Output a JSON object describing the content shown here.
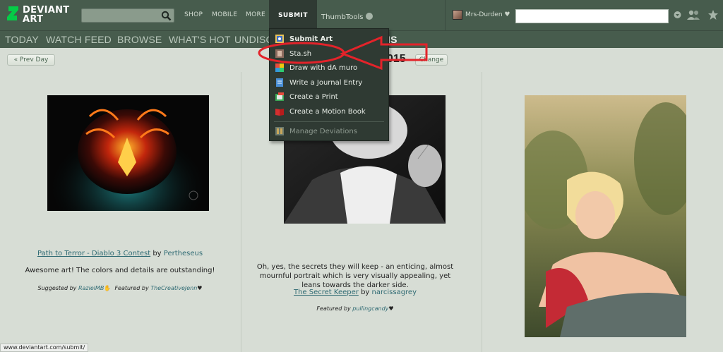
{
  "header": {
    "logo_line1": "DEVIANT",
    "logo_line2": "ART",
    "search": {
      "value": "",
      "placeholder": ""
    },
    "nav": {
      "shop": "SHOP",
      "mobile": "MOBILE",
      "more": "MORE",
      "submit": "SUBMIT",
      "thumbtools": "ThumbTools"
    },
    "username": "Mrs-Durden"
  },
  "subnav": {
    "items": [
      "TODAY",
      "WATCH FEED",
      "BROWSE",
      "WHAT'S HOT",
      "UNDISC",
      "IS"
    ]
  },
  "daybar": {
    "prev_label": "« Prev Day",
    "date_fragment": "015",
    "change_label": "Change"
  },
  "submit_menu": {
    "items": [
      {
        "label": "Submit Art",
        "icon": "submit-art-icon"
      },
      {
        "label": "Sta.sh",
        "icon": "stash-icon"
      },
      {
        "label": "Draw with dA muro",
        "icon": "muro-icon"
      },
      {
        "label": "Write a Journal Entry",
        "icon": "journal-icon"
      },
      {
        "label": "Create a Print",
        "icon": "print-icon"
      },
      {
        "label": "Create a Motion Book",
        "icon": "motion-book-icon"
      },
      {
        "label": "Manage Deviations",
        "icon": "manage-icon"
      }
    ]
  },
  "deviations": [
    {
      "title": "Path to Terror - Diablo 3 Contest",
      "by": "by",
      "artist": "Pertheseus",
      "comment": "Awesome art! The colors and details are outstanding!",
      "suggested_label": "Suggested by",
      "suggested_by": "RazielMB",
      "featured_label": "Featured by",
      "featured_by": "TheCreativeJenn"
    },
    {
      "comment": "Oh, yes, the secrets they will keep - an enticing, almost mournful portrait which is very visually appealing, yet leans towards the darker side.",
      "title": "The Secret Keeper",
      "by": "by",
      "artist": "narcissagrey",
      "featured_label": "Featured by",
      "featured_by": "pullingcandy"
    },
    {}
  ],
  "status_url": "www.deviantart.com/submit/",
  "colors": {
    "header": "#475c4d",
    "menu": "#2f3a33",
    "page": "#d7ddd5",
    "link": "#2f6a73",
    "annotation": "#e3232a"
  }
}
